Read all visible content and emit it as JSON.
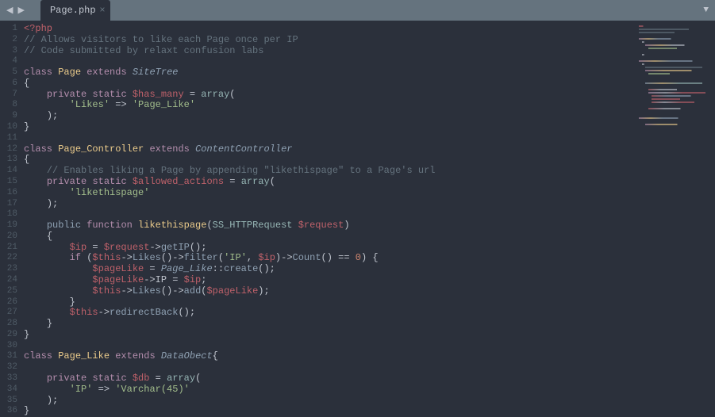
{
  "tab": {
    "label": "Page.php"
  },
  "lineNumbers": [
    "1",
    "2",
    "3",
    "4",
    "5",
    "6",
    "7",
    "8",
    "9",
    "10",
    "11",
    "12",
    "13",
    "14",
    "15",
    "16",
    "17",
    "18",
    "19",
    "20",
    "21",
    "22",
    "23",
    "24",
    "25",
    "26",
    "27",
    "28",
    "29",
    "30",
    "31",
    "32",
    "33",
    "34",
    "35",
    "36"
  ],
  "code": {
    "l1_open": "<?php",
    "l2_cmt": "// Allows visitors to like each Page once per IP",
    "l3_cmt": "// Code submitted by relaxt confusion labs",
    "l5_class": "class",
    "l5_name": "Page",
    "l5_ext": "extends",
    "l5_parent": "SiteTree",
    "l6_brace": "{",
    "l7_priv": "private",
    "l7_stat": "static",
    "l7_var": "$has_many",
    "l7_eq": " = ",
    "l7_arr": "array",
    "l7_paren": "(",
    "l8_key": "'Likes'",
    "l8_arrow": " => ",
    "l8_val": "'Page_Like'",
    "l9_close": ");",
    "l10_brace": "}",
    "l12_class": "class",
    "l12_name": "Page_Controller",
    "l12_ext": "extends",
    "l12_parent": "ContentController",
    "l13_brace": "{",
    "l14_cmt": "// Enables liking a Page by appending \"likethispage\" to a Page's url",
    "l15_priv": "private",
    "l15_stat": "static",
    "l15_var": "$allowed_actions",
    "l15_eq": " = ",
    "l15_arr": "array",
    "l15_paren": "(",
    "l16_val": "'likethispage'",
    "l17_close": ");",
    "l19_pub": "public",
    "l19_func": "function",
    "l19_name": "likethispage",
    "l19_po": "(",
    "l19_ptype": "SS_HTTPRequest",
    "l19_pvar": "$request",
    "l19_pc": ")",
    "l20_brace": "{",
    "l21_var": "$ip",
    "l21_eq": " = ",
    "l21_req": "$request",
    "l21_arrow": "->",
    "l21_fn": "getIP",
    "l21_call": "();",
    "l22_if": "if",
    "l22_po": " (",
    "l22_this": "$this",
    "l22_a1": "->",
    "l22_likes": "Likes",
    "l22_c1": "()->",
    "l22_filter": "filter",
    "l22_fo": "(",
    "l22_ipstr": "'IP'",
    "l22_comma": ", ",
    "l22_ipvar": "$ip",
    "l22_fc": ")->",
    "l22_count": "Count",
    "l22_cc": "() ",
    "l22_eqeq": "==",
    "l22_sp": " ",
    "l22_zero": "0",
    "l22_end": ") {",
    "l23_var": "$pageLike",
    "l23_eq": " = ",
    "l23_cls": "Page_Like",
    "l23_cc": "::",
    "l23_create": "create",
    "l23_call": "();",
    "l24_var": "$pageLike",
    "l24_arrow": "->",
    "l24_ip": "IP",
    "l24_eq": " = ",
    "l24_ipvar": "$ip",
    "l24_semi": ";",
    "l25_this": "$this",
    "l25_a1": "->",
    "l25_likes": "Likes",
    "l25_c1": "()->",
    "l25_add": "add",
    "l25_po": "(",
    "l25_var": "$pageLike",
    "l25_pc": ");",
    "l26_brace": "}",
    "l27_this": "$this",
    "l27_arrow": "->",
    "l27_fn": "redirectBack",
    "l27_call": "();",
    "l28_brace": "}",
    "l29_brace": "}",
    "l31_class": "class",
    "l31_name": "Page_Like",
    "l31_ext": "extends",
    "l31_parent": "DataObect",
    "l31_brace": "{",
    "l33_priv": "private",
    "l33_stat": "static",
    "l33_var": "$db",
    "l33_eq": " = ",
    "l33_arr": "array",
    "l33_paren": "(",
    "l34_key": "'IP'",
    "l34_arrow": " => ",
    "l34_val": "'Varchar(45)'",
    "l35_close": ");",
    "l36_brace": "}"
  }
}
